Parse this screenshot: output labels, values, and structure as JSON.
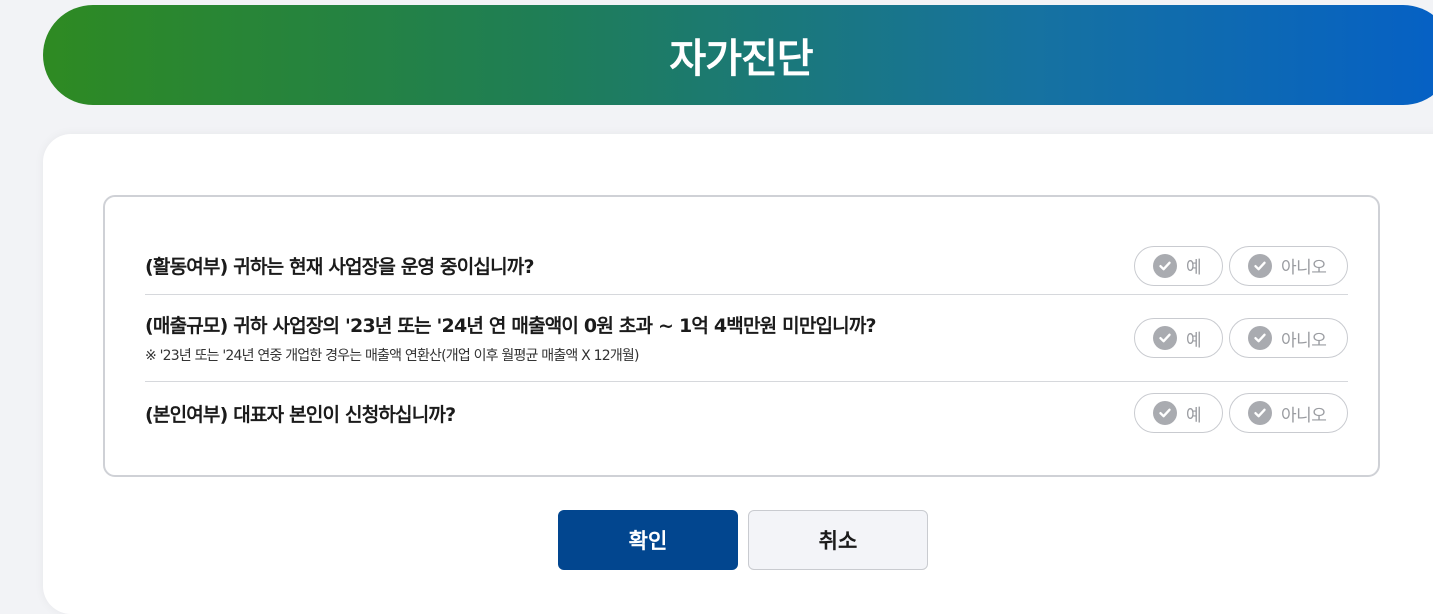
{
  "header": {
    "title": "자가진단"
  },
  "questions": [
    {
      "text": "(활동여부) 귀하는 현재 사업장을 운영 중이십니까?",
      "note": "",
      "yes_label": "예",
      "no_label": "아니오"
    },
    {
      "text": "(매출규모) 귀하 사업장의 '23년 또는 '24년 연 매출액이 0원 초과 ~ 1억 4백만원 미만입니까?",
      "note": "※ '23년 또는 '24년 연중 개업한 경우는 매출액 연환산(개업 이후 월평균 매출액 X 12개월)",
      "yes_label": "예",
      "no_label": "아니오"
    },
    {
      "text": "(본인여부) 대표자 본인이 신청하십니까?",
      "note": "",
      "yes_label": "예",
      "no_label": "아니오"
    }
  ],
  "buttons": {
    "confirm_label": "확인",
    "cancel_label": "취소"
  },
  "colors": {
    "header_start": "#2e8a22",
    "header_end": "#0560c6",
    "confirm_bg": "#02468f",
    "check_gray": "#a9abb0"
  },
  "icons": {
    "option_check": "check-circle-icon"
  }
}
